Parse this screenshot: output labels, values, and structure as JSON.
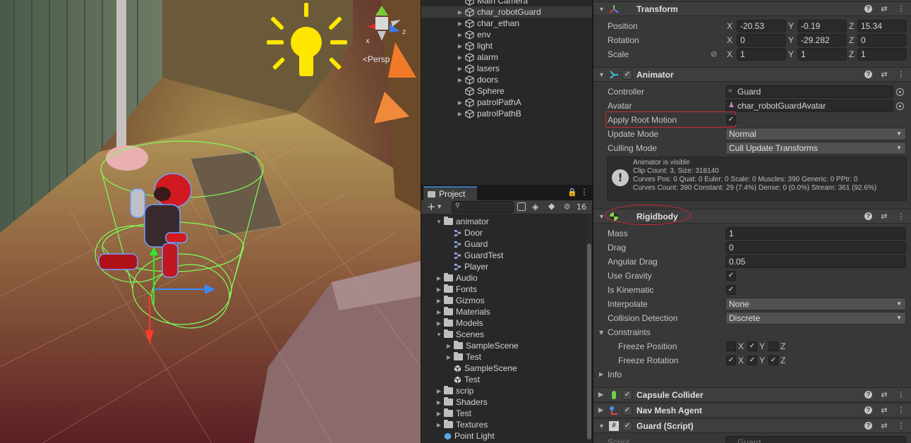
{
  "scene": {
    "persp_label": "Persp",
    "gizmo_x_label": "x",
    "gizmo_y_label": "y",
    "gizmo_z_label": "z"
  },
  "hierarchy": {
    "items": [
      {
        "label": "Main Camera",
        "has_arrow": false
      },
      {
        "label": "char_robotGuard",
        "has_arrow": true,
        "selected": true
      },
      {
        "label": "char_ethan",
        "has_arrow": true
      },
      {
        "label": "env",
        "has_arrow": true
      },
      {
        "label": "light",
        "has_arrow": true
      },
      {
        "label": "alarm",
        "has_arrow": true
      },
      {
        "label": "lasers",
        "has_arrow": true
      },
      {
        "label": "doors",
        "has_arrow": true
      },
      {
        "label": "Sphere",
        "has_arrow": false
      },
      {
        "label": "patrolPathA",
        "has_arrow": true
      },
      {
        "label": "patrolPathB",
        "has_arrow": true
      }
    ]
  },
  "project": {
    "tab_label": "Project",
    "hidden_count": "16",
    "items": [
      {
        "label": "animator",
        "kind": "folder-open",
        "indent": 0,
        "arrow": "open"
      },
      {
        "label": "Door",
        "kind": "anim",
        "indent": 1,
        "arrow": ""
      },
      {
        "label": "Guard",
        "kind": "anim",
        "indent": 1,
        "arrow": ""
      },
      {
        "label": "GuardTest",
        "kind": "anim",
        "indent": 1,
        "arrow": ""
      },
      {
        "label": "Player",
        "kind": "anim",
        "indent": 1,
        "arrow": ""
      },
      {
        "label": "Audio",
        "kind": "folder",
        "indent": 0,
        "arrow": "closed"
      },
      {
        "label": "Fonts",
        "kind": "folder",
        "indent": 0,
        "arrow": "closed"
      },
      {
        "label": "Gizmos",
        "kind": "folder",
        "indent": 0,
        "arrow": "closed"
      },
      {
        "label": "Materials",
        "kind": "folder",
        "indent": 0,
        "arrow": "closed"
      },
      {
        "label": "Models",
        "kind": "folder",
        "indent": 0,
        "arrow": "closed"
      },
      {
        "label": "Scenes",
        "kind": "folder-open",
        "indent": 0,
        "arrow": "open"
      },
      {
        "label": "SampleScene",
        "kind": "folder",
        "indent": 1,
        "arrow": "closed"
      },
      {
        "label": "Test",
        "kind": "folder",
        "indent": 1,
        "arrow": "closed"
      },
      {
        "label": "SampleScene",
        "kind": "unity",
        "indent": 1,
        "arrow": ""
      },
      {
        "label": "Test",
        "kind": "unity",
        "indent": 1,
        "arrow": ""
      },
      {
        "label": "scrip",
        "kind": "folder",
        "indent": 0,
        "arrow": "closed"
      },
      {
        "label": "Shaders",
        "kind": "folder",
        "indent": 0,
        "arrow": "closed"
      },
      {
        "label": "Test",
        "kind": "folder",
        "indent": 0,
        "arrow": "closed"
      },
      {
        "label": "Textures",
        "kind": "folder",
        "indent": 0,
        "arrow": "closed"
      },
      {
        "label": "Point Light",
        "kind": "light",
        "indent": 0,
        "arrow": ""
      }
    ]
  },
  "inspector": {
    "transform": {
      "title": "Transform",
      "position_label": "Position",
      "rotation_label": "Rotation",
      "scale_label": "Scale",
      "x": "X",
      "y": "Y",
      "z": "Z",
      "position": {
        "x": "-20.53",
        "y": "-0.19",
        "z": "15.34"
      },
      "rotation": {
        "x": "0",
        "y": "-29.282",
        "z": "0"
      },
      "scale": {
        "x": "1",
        "y": "1",
        "z": "1"
      }
    },
    "animator": {
      "title": "Animator",
      "controller_label": "Controller",
      "controller_value": "Guard",
      "avatar_label": "Avatar",
      "avatar_value": "char_robotGuardAvatar",
      "apply_root_motion_label": "Apply Root Motion",
      "update_mode_label": "Update Mode",
      "update_mode_value": "Normal",
      "culling_mode_label": "Culling Mode",
      "culling_mode_value": "Cull Update Transforms",
      "info": {
        "line1": "Animator is visible",
        "line2": "Clip Count: 3, Size: 318140",
        "line3": "Curves Pos: 0 Quat: 0 Euler: 0 Scale: 0 Muscles: 390 Generic: 0 PPtr: 0",
        "line4": "Curves Count: 390 Constant: 29 (7.4%) Dense: 0 (0.0%) Stream: 361 (92.6%)"
      }
    },
    "rigidbody": {
      "title": "Rigidbody",
      "mass_label": "Mass",
      "mass_value": "1",
      "drag_label": "Drag",
      "drag_value": "0",
      "angular_drag_label": "Angular Drag",
      "angular_drag_value": "0.05",
      "use_gravity_label": "Use Gravity",
      "is_kinematic_label": "Is Kinematic",
      "interpolate_label": "Interpolate",
      "interpolate_value": "None",
      "collision_label": "Collision Detection",
      "collision_value": "Discrete",
      "constraints_label": "Constraints",
      "freeze_position_label": "Freeze Position",
      "freeze_rotation_label": "Freeze Rotation",
      "info_label": "Info"
    },
    "capsule": {
      "title": "Capsule Collider"
    },
    "navmesh": {
      "title": "Nav Mesh Agent"
    },
    "guard_script": {
      "title": "Guard (Script)",
      "script_label": "Script",
      "script_value": "Guard"
    }
  },
  "colors": {
    "highlight_red": "#d7262e",
    "selection_blue": "#3a79bb",
    "light_yellow": "#ffe600"
  }
}
